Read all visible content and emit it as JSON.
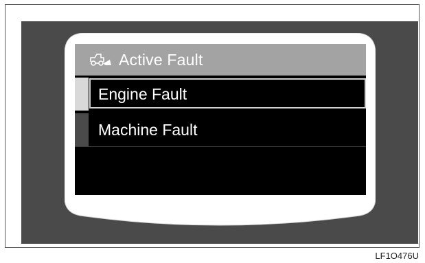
{
  "screen": {
    "title": "Active Fault",
    "title_icon": "machine-fault-icon",
    "menu_items": [
      {
        "label": "Engine Fault",
        "selected": true
      },
      {
        "label": "Machine Fault",
        "selected": false
      }
    ]
  },
  "figure_code": "LF1O476U",
  "colors": {
    "panel": "#4a4a4a",
    "bezel": "#ffffff",
    "screen": "#000000",
    "title_bar": "#a3a3a3",
    "text": "#ffffff"
  }
}
